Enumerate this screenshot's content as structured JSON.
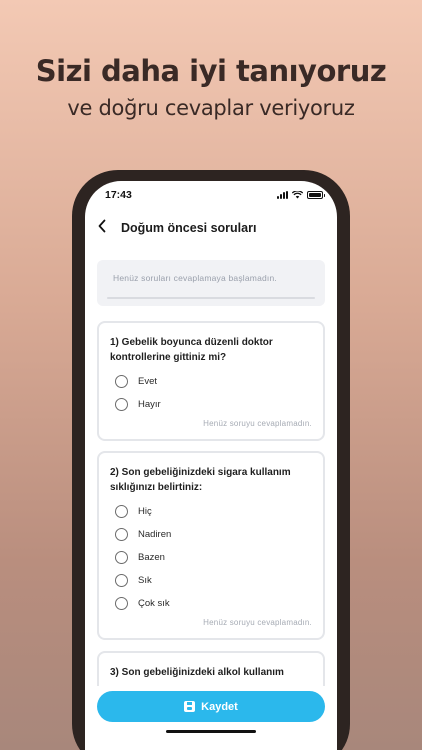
{
  "promo": {
    "headline": "Sizi daha iyi tanıyoruz",
    "subline": "ve doğru cevaplar veriyoruz"
  },
  "status_bar": {
    "time": "17:43"
  },
  "header": {
    "title": "Doğum öncesi soruları",
    "back_icon": "chevron-left-icon"
  },
  "progress": {
    "text": "Henüz soruları cevaplamaya başlamadın.",
    "fraction": 0
  },
  "questions": [
    {
      "title": "1) Gebelik boyunca düzenli doktor kontrollerine gittiniz mi?",
      "options": [
        "Evet",
        "Hayır"
      ],
      "status": "Henüz soruyu cevaplamadın."
    },
    {
      "title": "2) Son gebeliğinizdeki sigara kullanım sıklığınızı belirtiniz:",
      "options": [
        "Hiç",
        "Nadiren",
        "Bazen",
        "Sık",
        "Çok sık"
      ],
      "status": "Henüz soruyu cevaplamadın."
    },
    {
      "title": "3) Son gebeliğinizdeki alkol kullanım"
    }
  ],
  "footer": {
    "save_label": "Kaydet",
    "save_icon": "save-icon"
  },
  "colors": {
    "accent": "#2bb8ec",
    "background_top": "#f3c9b4",
    "background_bottom": "#a8877b"
  }
}
